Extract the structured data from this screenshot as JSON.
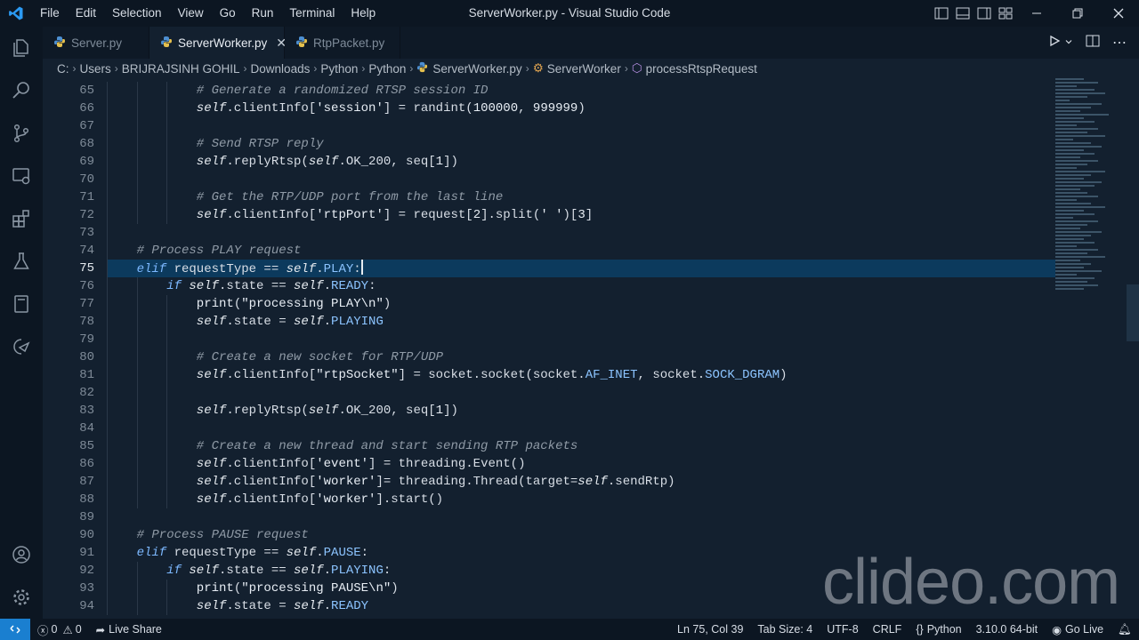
{
  "window": {
    "title": "ServerWorker.py - Visual Studio Code",
    "menu": [
      "File",
      "Edit",
      "Selection",
      "View",
      "Go",
      "Run",
      "Terminal",
      "Help"
    ]
  },
  "tabs": [
    {
      "label": "Server.py",
      "active": false
    },
    {
      "label": "ServerWorker.py",
      "active": true
    },
    {
      "label": "RtpPacket.py",
      "active": false
    }
  ],
  "breadcrumbs": [
    "C:",
    "Users",
    "BRIJRAJSINH GOHIL",
    "Downloads",
    "Python",
    "Python",
    "ServerWorker.py",
    "ServerWorker",
    "processRtspRequest"
  ],
  "editor": {
    "current_line": 75,
    "lines": [
      {
        "n": 65,
        "indent": 3,
        "tokens": [
          [
            "cm",
            "# Generate a randomized RTSP session ID"
          ]
        ]
      },
      {
        "n": 66,
        "indent": 3,
        "tokens": [
          [
            "slf",
            "self"
          ],
          [
            "",
            ".clientInfo["
          ],
          [
            "str",
            "'session'"
          ],
          [
            "",
            "] = randint("
          ],
          [
            "num",
            "100000"
          ],
          [
            "",
            ", "
          ],
          [
            "num",
            "999999"
          ],
          [
            "",
            ")"
          ]
        ]
      },
      {
        "n": 67,
        "indent": 3,
        "tokens": []
      },
      {
        "n": 68,
        "indent": 3,
        "tokens": [
          [
            "cm",
            "# Send RTSP reply"
          ]
        ]
      },
      {
        "n": 69,
        "indent": 3,
        "tokens": [
          [
            "slf",
            "self"
          ],
          [
            "",
            ".replyRtsp("
          ],
          [
            "slf",
            "self"
          ],
          [
            "",
            ".OK_200, seq["
          ],
          [
            "num",
            "1"
          ],
          [
            "",
            "])"
          ]
        ]
      },
      {
        "n": 70,
        "indent": 3,
        "tokens": []
      },
      {
        "n": 71,
        "indent": 3,
        "tokens": [
          [
            "cm",
            "# Get the RTP/UDP port from the last line"
          ]
        ]
      },
      {
        "n": 72,
        "indent": 3,
        "tokens": [
          [
            "slf",
            "self"
          ],
          [
            "",
            ".clientInfo["
          ],
          [
            "str",
            "'rtpPort'"
          ],
          [
            "",
            "] = request["
          ],
          [
            "num",
            "2"
          ],
          [
            "",
            "].split("
          ],
          [
            "str",
            "' '"
          ],
          [
            "",
            ")["
          ],
          [
            "num",
            "3"
          ],
          [
            "",
            "]"
          ]
        ]
      },
      {
        "n": 73,
        "indent": 1,
        "tokens": []
      },
      {
        "n": 74,
        "indent": 1,
        "tokens": [
          [
            "cm",
            "# Process PLAY request"
          ]
        ]
      },
      {
        "n": 75,
        "indent": 1,
        "tokens": [
          [
            "kw",
            "elif"
          ],
          [
            "",
            " requestType == "
          ],
          [
            "slf",
            "self"
          ],
          [
            "",
            "."
          ],
          [
            "attr",
            "PLAY"
          ],
          [
            "",
            ":"
          ]
        ]
      },
      {
        "n": 76,
        "indent": 2,
        "tokens": [
          [
            "kw",
            "if"
          ],
          [
            "",
            " "
          ],
          [
            "slf",
            "self"
          ],
          [
            "",
            ".state == "
          ],
          [
            "slf",
            "self"
          ],
          [
            "",
            "."
          ],
          [
            "attr",
            "READY"
          ],
          [
            "",
            ":"
          ]
        ]
      },
      {
        "n": 77,
        "indent": 3,
        "tokens": [
          [
            "fn",
            "print"
          ],
          [
            "",
            "("
          ],
          [
            "str",
            "\"processing PLAY\\n\""
          ],
          [
            "",
            ")"
          ]
        ]
      },
      {
        "n": 78,
        "indent": 3,
        "tokens": [
          [
            "slf",
            "self"
          ],
          [
            "",
            ".state = "
          ],
          [
            "slf",
            "self"
          ],
          [
            "",
            "."
          ],
          [
            "attr",
            "PLAYING"
          ]
        ]
      },
      {
        "n": 79,
        "indent": 3,
        "tokens": []
      },
      {
        "n": 80,
        "indent": 3,
        "tokens": [
          [
            "cm",
            "# Create a new socket for RTP/UDP"
          ]
        ]
      },
      {
        "n": 81,
        "indent": 3,
        "tokens": [
          [
            "slf",
            "self"
          ],
          [
            "",
            ".clientInfo["
          ],
          [
            "str",
            "\"rtpSocket\""
          ],
          [
            "",
            "] = socket.socket(socket."
          ],
          [
            "attr",
            "AF_INET"
          ],
          [
            "",
            ", socket."
          ],
          [
            "attr",
            "SOCK_DGRAM"
          ],
          [
            "",
            ")"
          ]
        ]
      },
      {
        "n": 82,
        "indent": 3,
        "tokens": []
      },
      {
        "n": 83,
        "indent": 3,
        "tokens": [
          [
            "slf",
            "self"
          ],
          [
            "",
            ".replyRtsp("
          ],
          [
            "slf",
            "self"
          ],
          [
            "",
            ".OK_200, seq["
          ],
          [
            "num",
            "1"
          ],
          [
            "",
            "])"
          ]
        ]
      },
      {
        "n": 84,
        "indent": 3,
        "tokens": []
      },
      {
        "n": 85,
        "indent": 3,
        "tokens": [
          [
            "cm",
            "# Create a new thread and start sending RTP packets"
          ]
        ]
      },
      {
        "n": 86,
        "indent": 3,
        "tokens": [
          [
            "slf",
            "self"
          ],
          [
            "",
            ".clientInfo["
          ],
          [
            "str",
            "'event'"
          ],
          [
            "",
            "] = threading.Event()"
          ]
        ]
      },
      {
        "n": 87,
        "indent": 3,
        "tokens": [
          [
            "slf",
            "self"
          ],
          [
            "",
            ".clientInfo["
          ],
          [
            "str",
            "'worker'"
          ],
          [
            "",
            "]= threading.Thread(target="
          ],
          [
            "slf",
            "self"
          ],
          [
            "",
            ".sendRtp)"
          ]
        ]
      },
      {
        "n": 88,
        "indent": 3,
        "tokens": [
          [
            "slf",
            "self"
          ],
          [
            "",
            ".clientInfo["
          ],
          [
            "str",
            "'worker'"
          ],
          [
            "",
            "].start()"
          ]
        ]
      },
      {
        "n": 89,
        "indent": 1,
        "tokens": []
      },
      {
        "n": 90,
        "indent": 1,
        "tokens": [
          [
            "cm",
            "# Process PAUSE request"
          ]
        ]
      },
      {
        "n": 91,
        "indent": 1,
        "tokens": [
          [
            "kw",
            "elif"
          ],
          [
            "",
            " requestType == "
          ],
          [
            "slf",
            "self"
          ],
          [
            "",
            "."
          ],
          [
            "attr",
            "PAUSE"
          ],
          [
            "",
            ":"
          ]
        ]
      },
      {
        "n": 92,
        "indent": 2,
        "tokens": [
          [
            "kw",
            "if"
          ],
          [
            "",
            " "
          ],
          [
            "slf",
            "self"
          ],
          [
            "",
            ".state == "
          ],
          [
            "slf",
            "self"
          ],
          [
            "",
            "."
          ],
          [
            "attr",
            "PLAYING"
          ],
          [
            "",
            ":"
          ]
        ]
      },
      {
        "n": 93,
        "indent": 3,
        "tokens": [
          [
            "fn",
            "print"
          ],
          [
            "",
            "("
          ],
          [
            "str",
            "\"processing PAUSE\\n\""
          ],
          [
            "",
            ")"
          ]
        ]
      },
      {
        "n": 94,
        "indent": 3,
        "tokens": [
          [
            "slf",
            "self"
          ],
          [
            "",
            ".state = "
          ],
          [
            "slf",
            "self"
          ],
          [
            "",
            "."
          ],
          [
            "attr",
            "READY"
          ]
        ]
      }
    ]
  },
  "watermark": "clideo.com",
  "statusbar": {
    "errors": "0",
    "warnings": "0",
    "live_share": "Live Share",
    "position": "Ln 75, Col 39",
    "tab_size": "Tab Size: 4",
    "encoding": "UTF-8",
    "eol": "CRLF",
    "language": "Python",
    "interpreter": "3.10.0 64-bit",
    "go_live": "Go Live"
  },
  "colors": {
    "editor_bg": "#13202f",
    "chrome_bg": "#0c1622",
    "current_line": "#0c3a5d",
    "remote_accent": "#1a7fd0"
  }
}
